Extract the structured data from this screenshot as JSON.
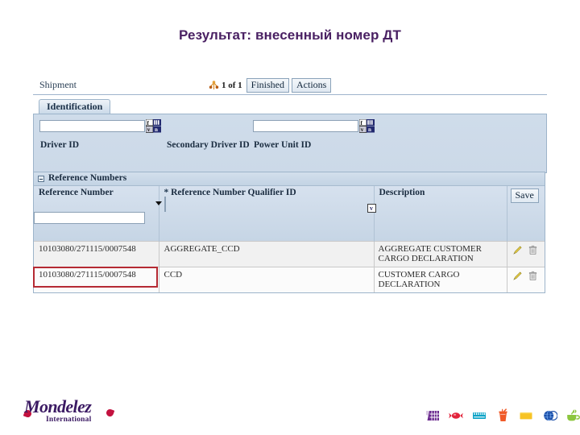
{
  "slide": {
    "title": "Результат: внесенный номер ДТ",
    "title_color": "#4a2163"
  },
  "app": {
    "toolbar": {
      "module_label": "Shipment",
      "record_count": "1 of 1",
      "nav_icon": "branch-hierarchy-icon",
      "buttons": [
        {
          "label": "Finished",
          "name": "finished-button"
        },
        {
          "label": "Actions",
          "name": "actions-button"
        }
      ]
    },
    "tabs": [
      {
        "label": "Identification",
        "name": "tab-identification",
        "active": true
      }
    ],
    "identification": {
      "fields": [
        {
          "label": "Driver ID",
          "value": "",
          "name": "driver-id-field"
        },
        {
          "label": "Secondary Driver ID",
          "value": "",
          "name": "secondary-driver-id-field"
        },
        {
          "label": "Power Unit ID",
          "value": "",
          "name": "power-unit-id-field"
        }
      ],
      "lookup_icon": "fv-lookup-icon"
    },
    "reference_numbers": {
      "section_title": "Reference Numbers",
      "collapsed": false,
      "columns": [
        {
          "label": "Reference Number",
          "required": false
        },
        {
          "label": "Reference Number Qualifier ID",
          "required": true,
          "required_mark": "*"
        },
        {
          "label": "Description",
          "required": false
        },
        {
          "label": "",
          "required": false
        }
      ],
      "entry_row": {
        "reference_number_value": "",
        "reference_number_placeholder": "",
        "qualifier_value": "",
        "qualifier_chip": "v",
        "save_label": "Save"
      },
      "rows": [
        {
          "reference_number": "10103080/271115/0007548",
          "qualifier": "AGGREGATE_CCD",
          "description": "AGGREGATE CUSTOMER CARGO DECLARATION",
          "highlighted": false,
          "edit_icon": "pencil-icon",
          "delete_icon": "trash-icon"
        },
        {
          "reference_number": "10103080/271115/0007548",
          "qualifier": "CCD",
          "description": "CUSTOMER CARGO DECLARATION",
          "highlighted": true,
          "highlight_color": "#b52a33",
          "edit_icon": "pencil-icon",
          "delete_icon": "trash-icon"
        }
      ]
    }
  },
  "footer": {
    "logo": {
      "wordmark": "Mondelez",
      "subtitle": "International",
      "purple": "#3b1a63",
      "red": "#c3123f"
    },
    "category_icons": [
      {
        "name": "chocolate-bar-icon",
        "color": "#6b2a8f"
      },
      {
        "name": "candy-icon",
        "color": "#e2233b"
      },
      {
        "name": "biscuit-icon",
        "color": "#0aa3c7"
      },
      {
        "name": "beverage-icon",
        "color": "#f05a28"
      },
      {
        "name": "cheese-icon",
        "color": "#f7c325"
      },
      {
        "name": "gum-icon",
        "color": "#1b4fa8"
      },
      {
        "name": "coffee-icon",
        "color": "#8cc63e"
      }
    ]
  }
}
